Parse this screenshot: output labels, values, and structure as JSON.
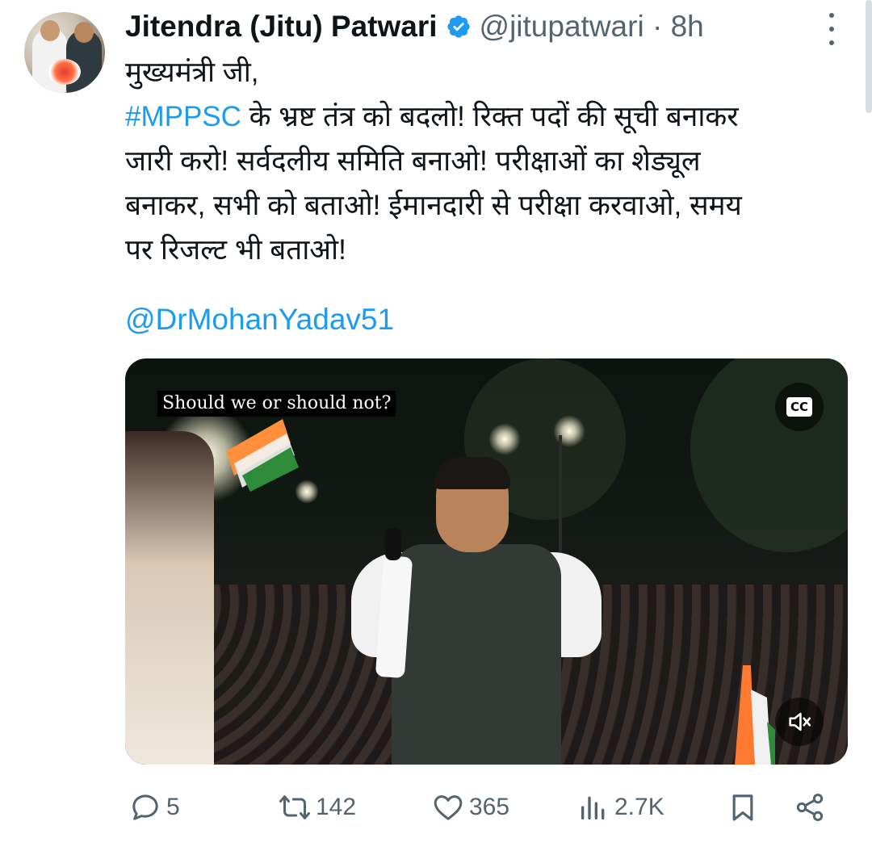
{
  "tweet": {
    "author_name": "Jitendra (Jitu) Patwari",
    "handle": "@jitupatwari",
    "separator": "·",
    "time": "8h",
    "text_lines": [
      "मुख्यमंत्री जी,",
      "के भ्रष्ट तंत्र को बदलो! रिक्त पदों की सूची बनाकर",
      "जारी करो! सर्वदलीय समिति बनाओ! परीक्षाओं का शेड्यूल",
      "बनाकर, सभी को बताओ! ईमानदारी से परीक्षा करवाओ, समय",
      "पर रिजल्ट भी बताओ!"
    ],
    "hashtag": "#MPPSC",
    "mention": "@DrMohanYadav51"
  },
  "media": {
    "caption": "Should we or should not?",
    "cc_label": "CC",
    "mute_icon": "volume-muted-icon"
  },
  "actions": {
    "reply_count": "5",
    "retweet_count": "142",
    "like_count": "365",
    "views_count": "2.7K",
    "icons": [
      "reply-icon",
      "retweet-icon",
      "like-icon",
      "views-icon",
      "bookmark-icon",
      "share-icon"
    ]
  },
  "colors": {
    "link": "#1d9bf0",
    "secondary_text": "#536471",
    "verified": "#1d9bf0"
  }
}
